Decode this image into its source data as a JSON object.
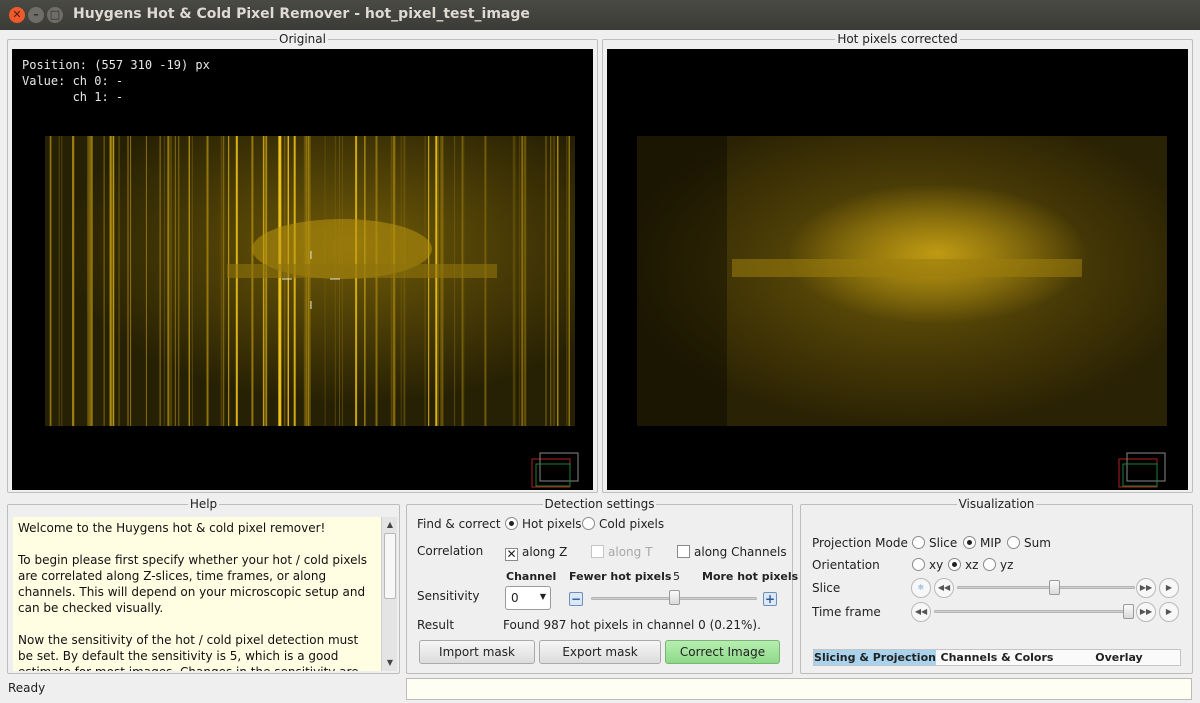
{
  "window": {
    "title": "Huygens Hot & Cold Pixel Remover - hot_pixel_test_image",
    "close_glyph": "✕",
    "min_glyph": "–",
    "max_glyph": "□"
  },
  "panels": {
    "original": {
      "title": "Original",
      "position_line": "Position: (557 310 -19) px",
      "value_line1": "Value: ch 0: -",
      "value_line2": "       ch 1: -"
    },
    "corrected": {
      "title": "Hot pixels corrected"
    }
  },
  "help": {
    "title": "Help",
    "paragraphs": [
      "Welcome to the Huygens hot & cold pixel  remover!",
      "To begin please first specify whether your hot / cold pixels are correlated along Z-slices, time frames, or along channels. This will depend on your microscopic setup and can be checked visually.",
      "Now the sensitivity of the hot / cold pixel detection must be set. By default the sensitivity is 5, which is a good estimate for most images. Changes in the sensitivity are immediately reflected in the corrected image, highlighted in yellow, and the number of corrected"
    ]
  },
  "detection": {
    "title": "Detection settings",
    "find_label": "Find & correct",
    "hot_label": "Hot pixels",
    "cold_label": "Cold pixels",
    "hot_selected": true,
    "correlation_label": "Correlation",
    "along_z": "along Z",
    "along_z_checked": true,
    "along_t": "along T",
    "along_t_enabled": false,
    "along_channels": "along Channels",
    "along_channels_checked": false,
    "channel_header": "Channel",
    "fewer_label": "Fewer hot pixels",
    "sensitivity_value": "5",
    "more_label": "More hot pixels",
    "sensitivity_label": "Sensitivity",
    "channel_value": "0",
    "sensitivity_fraction": 0.5,
    "result_label": "Result",
    "result_text": "Found 987 hot pixels in  channel 0 (0.21%).",
    "import_label": "Import mask",
    "export_label": "Export mask",
    "correct_label": "Correct Image",
    "minus_glyph": "−",
    "plus_glyph": "+",
    "combo_arrow": "▼"
  },
  "visualization": {
    "title": "Visualization",
    "projection_label": "Projection Mode",
    "projection_options": [
      "Slice",
      "MIP",
      "Sum"
    ],
    "projection_selected": "MIP",
    "orientation_label": "Orientation",
    "orientation_options": [
      "xy",
      "xz",
      "yz"
    ],
    "orientation_selected": "xz",
    "slice_label": "Slice",
    "slice_fraction": 0.55,
    "timeframe_label": "Time frame",
    "timeframe_fraction": 1.0,
    "play_back_glyph": "◀◀",
    "play_fwd_glyph": "▶▶",
    "step_fwd_glyph": "▶",
    "tabs": [
      "Slicing & Projection",
      "Channels & Colors",
      "Overlay"
    ],
    "active_tab": "Slicing & Projection"
  },
  "status": {
    "text": "Ready"
  },
  "icons": {
    "scroll_up": "▲",
    "scroll_down": "▼"
  }
}
